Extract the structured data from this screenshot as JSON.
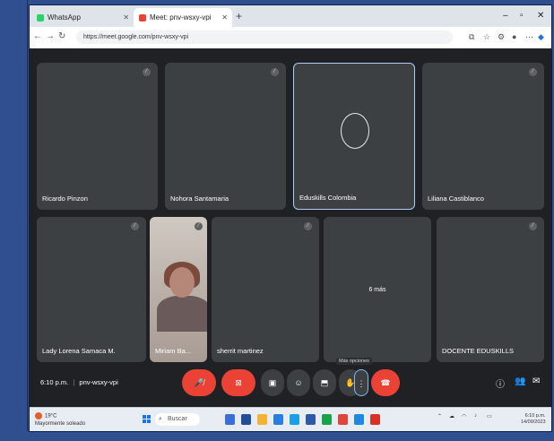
{
  "browser": {
    "tabs": [
      {
        "label": "WhatsApp",
        "active": false
      },
      {
        "label": "Meet: pnv-wsxy-vpi",
        "active": true
      }
    ],
    "url": "https://meet.google.com/pnv-wsxy-vpi"
  },
  "meet": {
    "participants": [
      {
        "name": "Ricardo Pinzon"
      },
      {
        "name": "Nohora Santamaria"
      },
      {
        "name": "Eduskills Colombia"
      },
      {
        "name": "Liliana Castiblanco"
      },
      {
        "name": "Lady Lorena Samaca M."
      },
      {
        "name": "Miriam Ba..."
      },
      {
        "name": "sherrit martinez"
      },
      {
        "name": "DOCENTE EDUSKILLS"
      }
    ],
    "more_label": "6 más",
    "time": "6:10 p.m.",
    "meeting_code": "pnv-wsxy-vpi",
    "tooltip": "Más opciones"
  },
  "taskbar": {
    "weather_temp": "19°C",
    "weather_desc": "Mayormente soleado",
    "search_placeholder": "Buscar",
    "time": "6:10 p.m.",
    "date": "14/09/2023"
  },
  "colors": {
    "end_call": "#ea4335",
    "tile": "#3c4043",
    "meet_bg": "#202124"
  }
}
